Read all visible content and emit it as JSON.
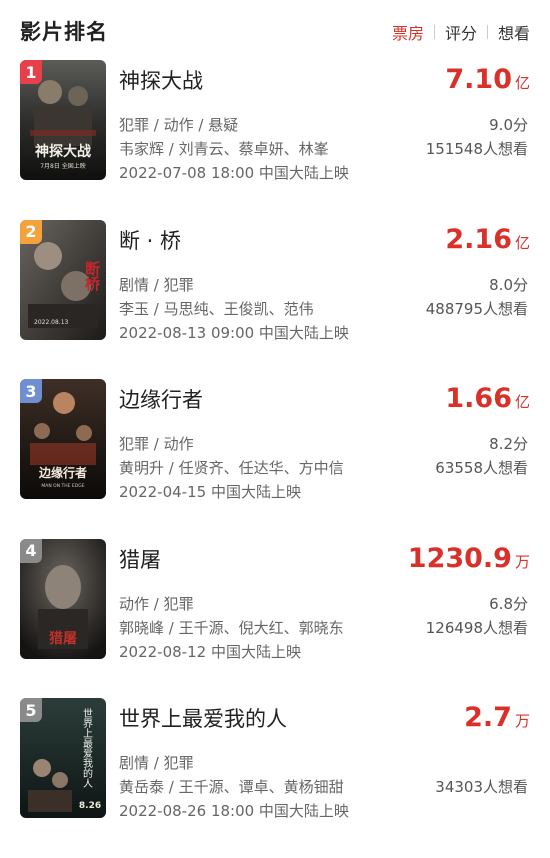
{
  "header": {
    "title": "影片排名",
    "tabs": [
      {
        "label": "票房",
        "active": true
      },
      {
        "label": "评分",
        "active": false
      },
      {
        "label": "想看",
        "active": false
      }
    ]
  },
  "colors": {
    "accent": "#d9302a",
    "rank_1": "#e8404a",
    "rank_2": "#f4a23c",
    "rank_3": "#6f8fd0",
    "rank_other": "#8a8a8a"
  },
  "movies": [
    {
      "rank": "1",
      "name": "神探大战",
      "box_office": "7.10",
      "unit": "亿",
      "genre": "犯罪 / 动作 / 悬疑",
      "score": "9.0分",
      "actors": "韦家辉 / 刘青云、蔡卓妍、林峯",
      "want": "151548人想看",
      "release": "2022-07-08 18:00 中国大陆上映",
      "poster_title": "神探大战",
      "poster_subtitle": "7月8日 全国上映"
    },
    {
      "rank": "2",
      "name": "断 · 桥",
      "box_office": "2.16",
      "unit": "亿",
      "genre": "剧情 / 犯罪",
      "score": "8.0分",
      "actors": "李玉 / 马思纯、王俊凯、范伟",
      "want": "488795人想看",
      "release": "2022-08-13 09:00 中国大陆上映",
      "poster_title": "断桥",
      "poster_subtitle": "2022.08.13"
    },
    {
      "rank": "3",
      "name": "边缘行者",
      "box_office": "1.66",
      "unit": "亿",
      "genre": "犯罪 / 动作",
      "score": "8.2分",
      "actors": "黄明升 / 任贤齐、任达华、方中信",
      "want": "63558人想看",
      "release": "2022-04-15 中国大陆上映",
      "poster_title": "边缘行者",
      "poster_subtitle": "MAN ON THE EDGE"
    },
    {
      "rank": "4",
      "name": "猎屠",
      "box_office": "1230.9",
      "unit": "万",
      "genre": "动作 / 犯罪",
      "score": "6.8分",
      "actors": "郭晓峰 / 王千源、倪大红、郭晓东",
      "want": "126498人想看",
      "release": "2022-08-12 中国大陆上映",
      "poster_title": "猎屠",
      "poster_subtitle": ""
    },
    {
      "rank": "5",
      "name": "世界上最爱我的人",
      "box_office": "2.7",
      "unit": "万",
      "genre": "剧情 / 犯罪",
      "score": "",
      "actors": "黄岳泰 / 王千源、谭卓、黄杨钿甜",
      "want": "34303人想看",
      "release": "2022-08-26 18:00 中国大陆上映",
      "poster_title": "世界上最爱我的人",
      "poster_subtitle": "8.26"
    }
  ]
}
